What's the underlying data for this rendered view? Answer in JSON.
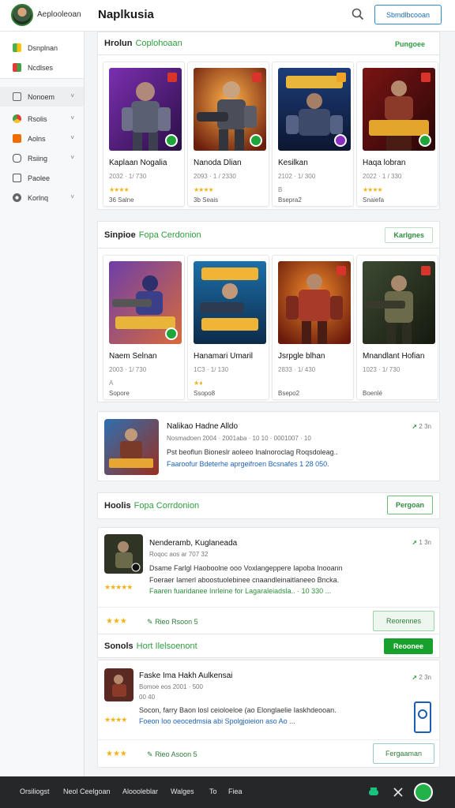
{
  "header": {
    "user_name": "Aeplooleoan",
    "brand": "Naplkusia",
    "action_label": "Sbmdlbcooan"
  },
  "sidebar": {
    "top_items": [
      {
        "label": "Dsnplnan",
        "icon": "grid-icon"
      },
      {
        "label": "Ncdlses",
        "icon": "puzzle-icon"
      }
    ],
    "items": [
      {
        "label": "Nonoem",
        "icon": "folder-icon"
      },
      {
        "label": "Rsolis",
        "icon": "chrome-icon"
      },
      {
        "label": "Aolns",
        "icon": "flame-icon"
      },
      {
        "label": "Rsiing",
        "icon": "gamepad-icon"
      },
      {
        "label": "Paolee",
        "icon": "document-icon"
      },
      {
        "label": "Korlnq",
        "icon": "disc-icon"
      }
    ]
  },
  "section1": {
    "title": "Hrolun",
    "accent": "Coplohoaan",
    "button": "Pungoee",
    "cards": [
      {
        "title": "Kaplaan Nogalia",
        "meta": "2032 · 1/ 730",
        "stars": "★★★★",
        "foot": "36 Salne"
      },
      {
        "title": "Nanoda Dlian",
        "meta": "2093 · 1 / 2330",
        "stars": "★★★★",
        "foot": "3b Seais"
      },
      {
        "title": "Kesilkan",
        "meta": "2102 · 1/ 300",
        "stars": "B",
        "foot": "Bsepra2"
      },
      {
        "title": "Haqa lobran",
        "meta": "2022 · 1 / 330",
        "stars": "★★★★",
        "foot": "Snaiefa"
      }
    ]
  },
  "section2": {
    "title": "Sinpioe",
    "accent": "Fopa Cerdonion",
    "button": "Karlgnes",
    "cards": [
      {
        "title": "Naem Selnan",
        "meta": "2003 · 1/ 730",
        "stars": "A",
        "foot": "Sopore"
      },
      {
        "title": "Hanamari Umaril",
        "meta": "1C3 · 1/ 130",
        "stars": "★ ♦",
        "foot": "Ssopo8"
      },
      {
        "title": "Jsrpgle blhan",
        "meta": "2833 · 1/ 430",
        "stars": "",
        "foot": "Bsepo2"
      },
      {
        "title": "Mnandlant Hofian",
        "meta": "1023 · 1/ 730",
        "stars": "",
        "foot": "Boenlé"
      }
    ]
  },
  "feature1": {
    "title": "Nalikao Hadne Alldo",
    "sub": "Nosmadoen 2004 · 2001aba · 10 10 · 0001007 · 10",
    "desc": "Pst beoflun Bioneslr aoleeo Inalnoroclag Roqsdoleag..",
    "link": "Faaroofur Bdeterhe aprgeifroen Bcsnafes 1 28 050.",
    "trend": "2 3n"
  },
  "section3": {
    "title": "Hoolis",
    "accent": "Fopa Corrdonion",
    "button": "Pergoan"
  },
  "feature2": {
    "title": "Nenderamb, Kuglaneada",
    "sub": "Roqoc aos ar 707 32",
    "desc1": "Dsame Farlgl Haoboolne ooo Voxlangeppere Iapoba Inooann",
    "desc2": "Foeraer Iamerl aboostuolebinee cnaandleinaitlaneeo Bncka.",
    "link": "Faaren fuaridanee Inrleine for Lagaraleiadsla.. · 10 330 ...",
    "stars": "★★★★★",
    "trend": "1 3n",
    "foot_stars": "★★★",
    "foot_link": "Rieo Rsoon",
    "foot_chev": "5",
    "foot_button": "Reorennes"
  },
  "section4": {
    "title": "Sonols",
    "accent": "Hort Ilelsoenont",
    "button": "Reoonee"
  },
  "feature3": {
    "title": "Faske Ima Hakh Aulkensai",
    "sub": "Bomoe eos 2001 · 500",
    "sub2": "00 40",
    "desc": "Socon, farry Baon losl ceioloeloe (ao Elonglaelie Iaskhdeooan.",
    "link": "Foeon Ioo oeocedmsia abi Spolgjoieion aso Ao ...",
    "stars": "★★★★",
    "trend": "2 3n",
    "foot_stars": "★★★",
    "foot_link": "Rieo Asoon",
    "foot_chev": "5",
    "foot_button": "Fergaaman"
  },
  "bottombar": {
    "items": [
      "Orsiliogst",
      "Neol Ceelgoan",
      "Aloooleblar",
      "Walges",
      "To",
      "Fiea"
    ]
  },
  "colors": {
    "accent_green": "#2f9e3f",
    "button_blue": "#1c6db3",
    "star_yellow": "#f2b21b",
    "bottom_bg": "#262728"
  }
}
